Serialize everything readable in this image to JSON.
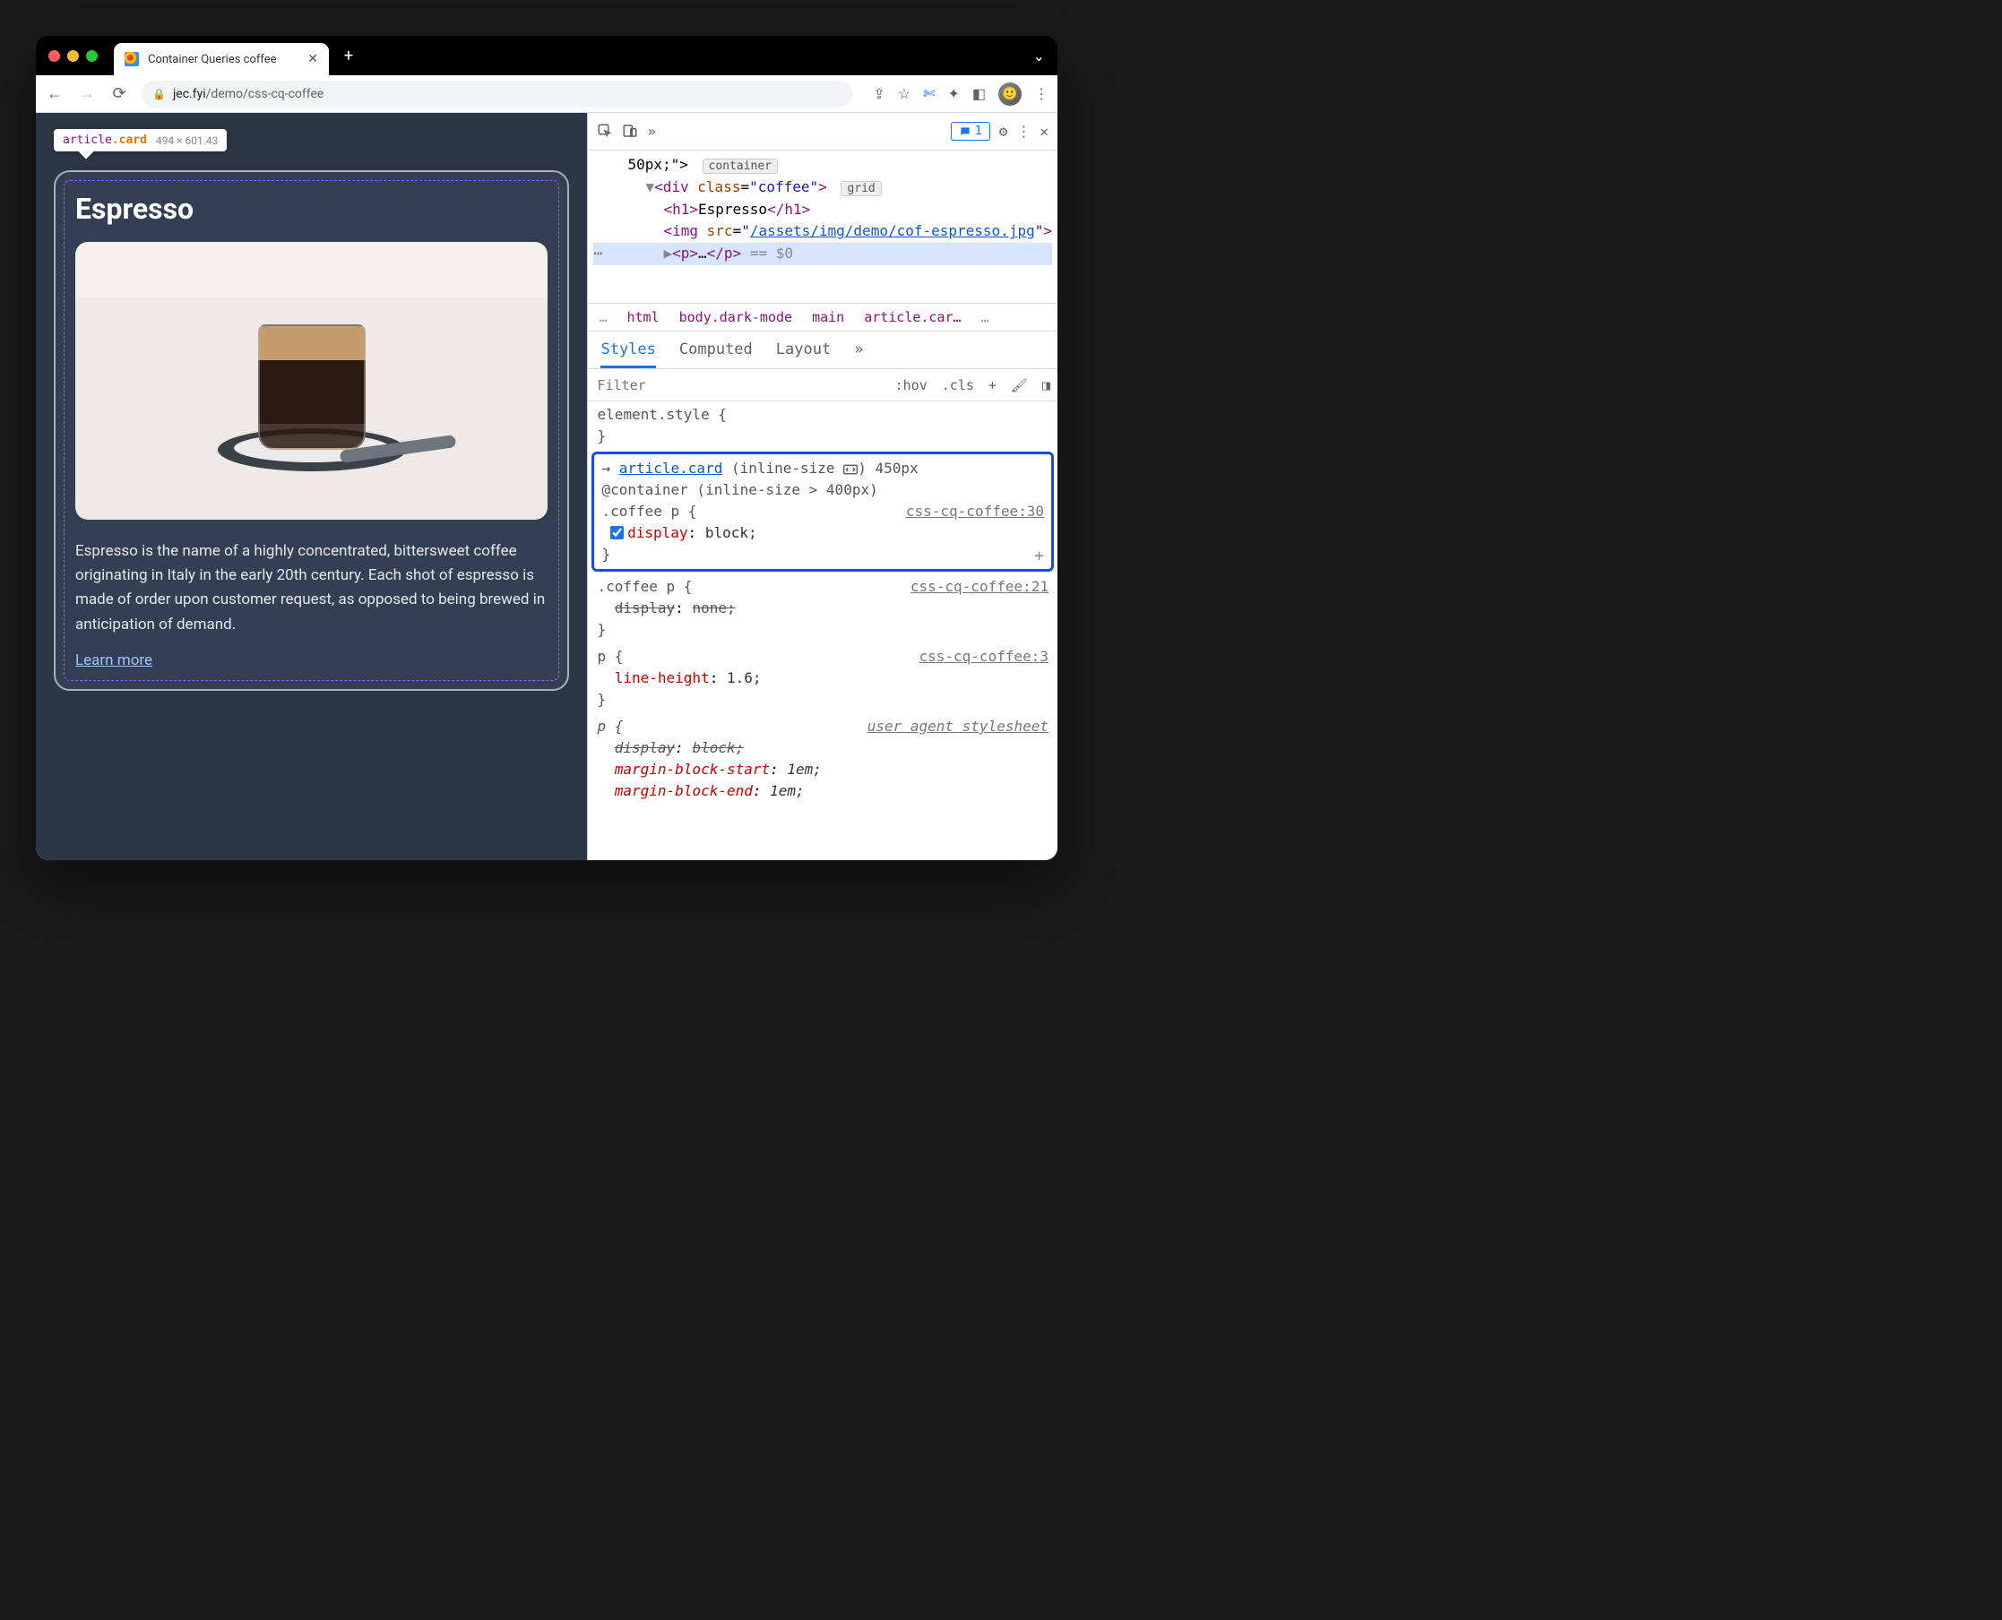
{
  "window": {
    "tab_title": "Container Queries coffee",
    "url_host": "jec.fyi",
    "url_path": "/demo/css-cq-coffee"
  },
  "hover_tip": {
    "tag": "article",
    "cls": ".card",
    "dims": "494 × 601.43"
  },
  "page": {
    "heading": "Espresso",
    "description": "Espresso is the name of a highly concentrated, bittersweet coffee originating in Italy in the early 20th century. Each shot of espresso is made of order upon customer request, as opposed to being brewed in anticipation of demand.",
    "link": "Learn more"
  },
  "devtools": {
    "messages_count": "1",
    "dom": {
      "style_frag": "50px;\">",
      "container_badge": "container",
      "div_class": "coffee",
      "grid_badge": "grid",
      "h1_text": "Espresso",
      "img_src": "/assets/img/demo/cof-espresso.jpg",
      "p_sel": "== $0"
    },
    "crumbs": [
      "…",
      "html",
      "body.dark-mode",
      "main",
      "article.car…",
      "…"
    ],
    "style_tabs": [
      "Styles",
      "Computed",
      "Layout",
      "»"
    ],
    "filter_placeholder": "Filter",
    "filter_buttons": [
      ":hov",
      ".cls"
    ],
    "rules": {
      "elstyle": "element.style {",
      "cq": {
        "article": "article.card",
        "inline_label": "(inline-size",
        "size": "450px",
        "media": "@container (inline-size > 400px)"
      },
      "r1": {
        "sel": ".coffee p {",
        "src": "css-cq-coffee:30",
        "prop": "display",
        "val": "block;"
      },
      "r2": {
        "sel": ".coffee p {",
        "src": "css-cq-coffee:21",
        "prop": "display",
        "val": "none;"
      },
      "r3": {
        "sel": "p {",
        "src": "css-cq-coffee:3",
        "prop": "line-height",
        "val": "1.6;"
      },
      "r4": {
        "sel": "p {",
        "src": "user agent stylesheet",
        "p1p": "display",
        "p1v": "block;",
        "p2p": "margin-block-start",
        "p2v": "1em;",
        "p3p": "margin-block-end",
        "p3v": "1em;"
      }
    }
  }
}
